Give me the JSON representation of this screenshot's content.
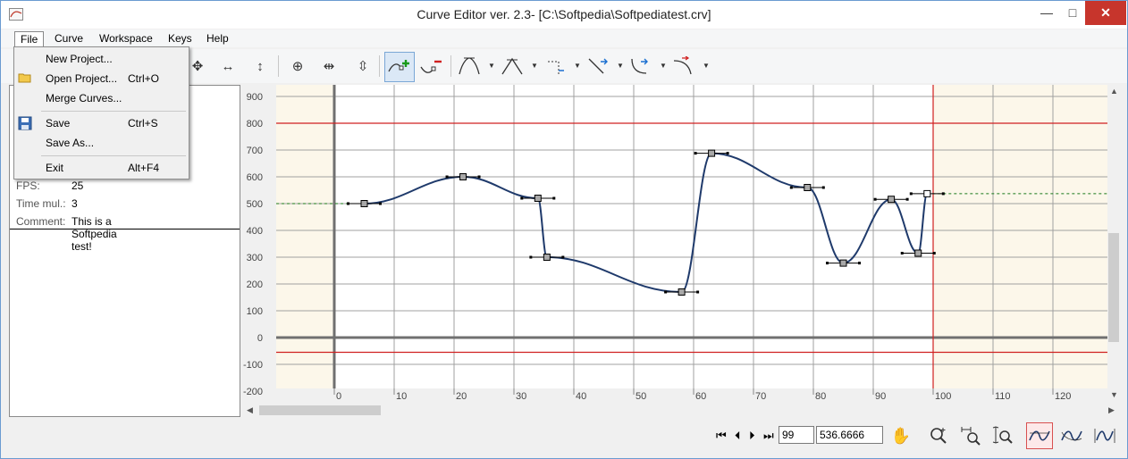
{
  "window": {
    "title": "Curve Editor ver. 2.3- [C:\\Softpedia\\Softpediatest.crv]",
    "minimize": "—",
    "maximize": "□",
    "close": "✕"
  },
  "menubar": {
    "items": [
      "File",
      "Curve",
      "Workspace",
      "Keys",
      "Help"
    ],
    "active": "File"
  },
  "file_menu": {
    "items": [
      {
        "label": "New Project...",
        "shortcut": "",
        "icon": "new-project-icon"
      },
      {
        "label": "Open Project...",
        "shortcut": "Ctrl+O",
        "icon": "open-folder-icon"
      },
      {
        "label": "Merge Curves...",
        "shortcut": "",
        "icon": ""
      },
      {
        "label": "Save",
        "shortcut": "Ctrl+S",
        "icon": "floppy-disk-icon"
      },
      {
        "label": "Save As...",
        "shortcut": "",
        "icon": ""
      },
      {
        "label": "Exit",
        "shortcut": "Alt+F4",
        "icon": ""
      }
    ]
  },
  "properties": {
    "fps_label": "FPS:",
    "fps_value": "25",
    "time_mul_label": "Time mul.:",
    "time_mul_value": "3",
    "comment_label": "Comment:",
    "comment_value": "This is a Softpedia test!"
  },
  "navigation": {
    "frame_value": "99",
    "value_field": "536.6666"
  },
  "colors": {
    "curve": "#1f3a6b",
    "highlight_band": "#fcf7ea",
    "red_line": "#d02020",
    "grid": "#a0a0a0",
    "axis": "#707070"
  },
  "chart_data": {
    "type": "line",
    "xlim": [
      -10,
      130
    ],
    "ylim": [
      -200,
      900
    ],
    "x_ticks": [
      0,
      10,
      20,
      30,
      40,
      50,
      60,
      70,
      80,
      90,
      100,
      110,
      120
    ],
    "y_ticks": [
      900,
      800,
      700,
      600,
      500,
      400,
      300,
      200,
      100,
      0,
      -100,
      -200
    ],
    "range_start": 0,
    "range_end": 100,
    "red_hlines": [
      800,
      -55
    ],
    "keys": [
      {
        "x": 5,
        "y": 500
      },
      {
        "x": 21.5,
        "y": 600
      },
      {
        "x": 34,
        "y": 520
      },
      {
        "x": 35.5,
        "y": 300
      },
      {
        "x": 58,
        "y": 170
      },
      {
        "x": 63,
        "y": 688
      },
      {
        "x": 79,
        "y": 560
      },
      {
        "x": 85,
        "y": 278
      },
      {
        "x": 93,
        "y": 516
      },
      {
        "x": 97.5,
        "y": 315
      },
      {
        "x": 99,
        "y": 537
      }
    ],
    "pre_extrapolate_y": 500,
    "post_extrapolate_y": 537
  }
}
